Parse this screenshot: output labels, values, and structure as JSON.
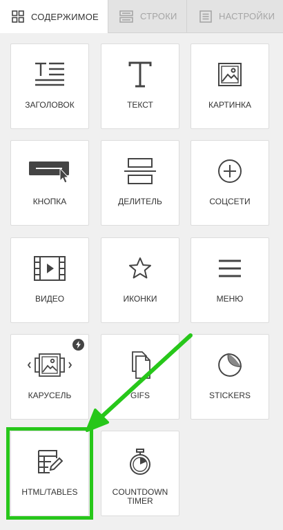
{
  "tabs": [
    {
      "label": "Содержимое",
      "icon": "grid-icon",
      "active": true
    },
    {
      "label": "Строки",
      "icon": "rows-icon",
      "active": false
    },
    {
      "label": "Настройки",
      "icon": "settings-icon",
      "active": false
    }
  ],
  "tiles": [
    {
      "label": "Заголовок",
      "icon": "heading-icon"
    },
    {
      "label": "Текст",
      "icon": "text-icon"
    },
    {
      "label": "Картинка",
      "icon": "image-icon"
    },
    {
      "label": "Кнопка",
      "icon": "button-icon"
    },
    {
      "label": "Делитель",
      "icon": "divider-icon"
    },
    {
      "label": "Соцсети",
      "icon": "social-icon"
    },
    {
      "label": "Видео",
      "icon": "video-icon"
    },
    {
      "label": "Иконки",
      "icon": "star-icon"
    },
    {
      "label": "Меню",
      "icon": "menu-icon"
    },
    {
      "label": "Карусель",
      "icon": "carousel-icon",
      "badge": "lightning-icon"
    },
    {
      "label": "GIFS",
      "icon": "gifs-icon"
    },
    {
      "label": "STICKERS",
      "icon": "sticker-icon"
    },
    {
      "label": "HTML/TABLES",
      "icon": "html-tables-icon"
    },
    {
      "label": "COUNTDOWN TIMER",
      "icon": "stopwatch-icon"
    }
  ],
  "colors": {
    "highlight": "#27c71a",
    "icon": "#444444"
  }
}
